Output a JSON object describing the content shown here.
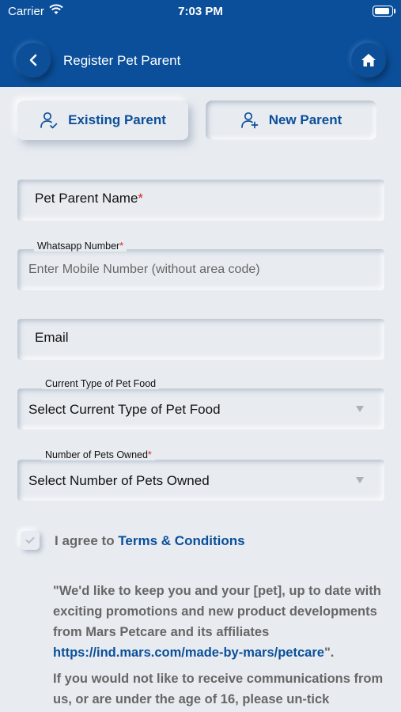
{
  "status_bar": {
    "carrier": "Carrier",
    "time": "7:03 PM"
  },
  "header": {
    "title": "Register Pet Parent"
  },
  "tabs": [
    {
      "label": "Existing Parent",
      "icon": "user-check-icon",
      "active": true
    },
    {
      "label": "New Parent",
      "icon": "user-plus-icon",
      "active": false
    }
  ],
  "form": {
    "name": {
      "label": "Pet Parent Name",
      "required_mark": "*"
    },
    "whatsapp": {
      "label": "Whatsapp Number",
      "required_mark": "*",
      "placeholder": "Enter Mobile Number (without area code)"
    },
    "email": {
      "label": "Email"
    },
    "pet_food": {
      "label": "Current Type of Pet Food",
      "value": "Select Current Type of Pet Food"
    },
    "pets_owned": {
      "label": "Number of Pets Owned",
      "required_mark": "*",
      "value": "Select Number of Pets Owned"
    }
  },
  "agree": {
    "prefix": "I agree to ",
    "link": "Terms & Conditions"
  },
  "consent": {
    "p1_text": "\"We'd like to keep you and your [pet], up to date with exciting promotions and new product developments from Mars Petcare and its affiliates ",
    "p1_link": "https://ind.mars.com/made-by-mars/petcare",
    "p1_end": "\".",
    "p2_text": "If you would not like to receive communications from us, or are under the age of 16, please un-tick"
  },
  "colors": {
    "brand_blue": "#0b4f9a",
    "background": "#e8ecf1",
    "required": "#d22222"
  }
}
